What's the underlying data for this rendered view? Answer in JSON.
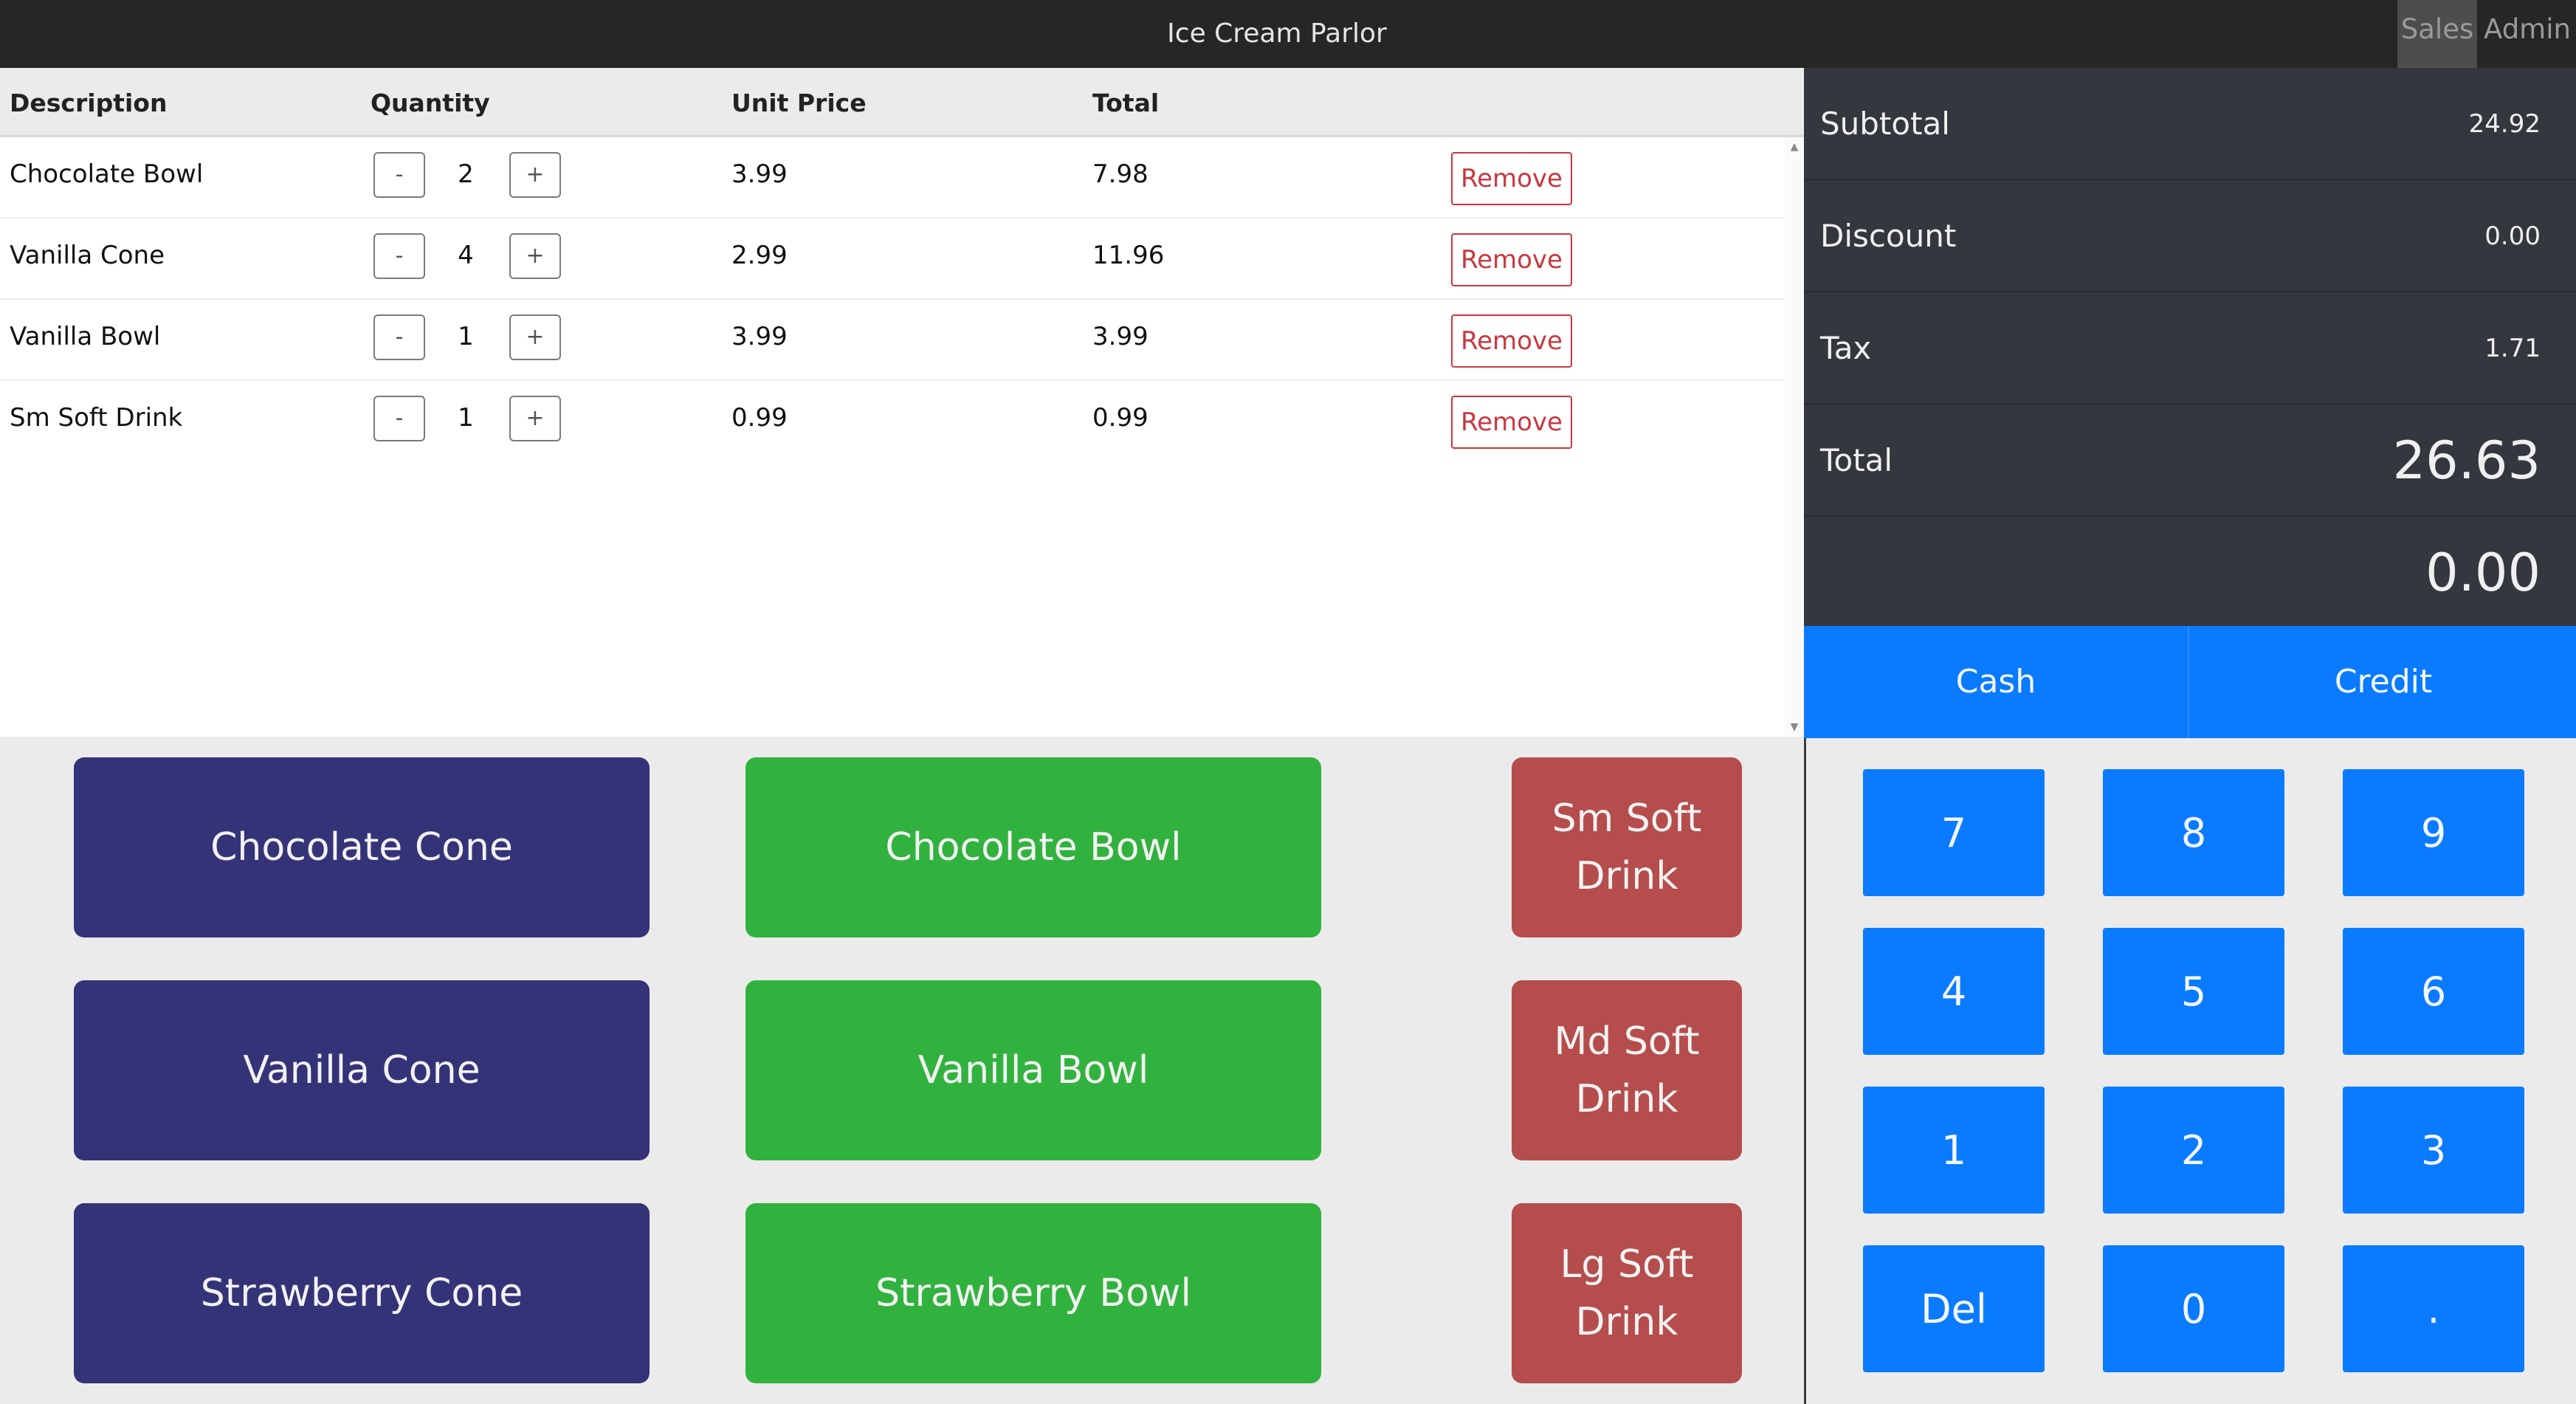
{
  "header": {
    "title": "Ice Cream Parlor",
    "nav": {
      "sales": "Sales",
      "admin": "Admin",
      "active": "Sales"
    }
  },
  "order_table": {
    "columns": [
      "Description",
      "Quantity",
      "Unit Price",
      "Total"
    ],
    "minus_label": "-",
    "plus_label": "+",
    "remove_label": "Remove",
    "rows": [
      {
        "description": "Chocolate Bowl",
        "quantity": "2",
        "unit_price": "3.99",
        "total": "7.98"
      },
      {
        "description": "Vanilla Cone",
        "quantity": "4",
        "unit_price": "2.99",
        "total": "11.96"
      },
      {
        "description": "Vanilla Bowl",
        "quantity": "1",
        "unit_price": "3.99",
        "total": "3.99"
      },
      {
        "description": "Sm Soft Drink",
        "quantity": "1",
        "unit_price": "0.99",
        "total": "0.99"
      }
    ]
  },
  "products": {
    "cones": [
      "Chocolate Cone",
      "Vanilla Cone",
      "Strawberry Cone"
    ],
    "bowls": [
      "Chocolate Bowl",
      "Vanilla Bowl",
      "Strawberry Bowl"
    ],
    "drinks": [
      "Sm Soft Drink",
      "Md Soft Drink",
      "Lg Soft Drink"
    ]
  },
  "totals": {
    "subtotal_label": "Subtotal",
    "subtotal": "24.92",
    "discount_label": "Discount",
    "discount": "0.00",
    "tax_label": "Tax",
    "tax": "1.71",
    "total_label": "Total",
    "total": "26.63",
    "tendered": "0.00"
  },
  "payment": {
    "cash": "Cash",
    "credit": "Credit"
  },
  "keypad": [
    "7",
    "8",
    "9",
    "4",
    "5",
    "6",
    "1",
    "2",
    "3",
    "Del",
    "0",
    "."
  ],
  "colors": {
    "cone_button": "#353378",
    "bowl_button": "#31b23e",
    "drink_button": "#b54d4d",
    "primary_blue": "#0a7bff",
    "remove_red": "#c9373f",
    "totals_background": "#34373d",
    "header_background": "#262626"
  }
}
